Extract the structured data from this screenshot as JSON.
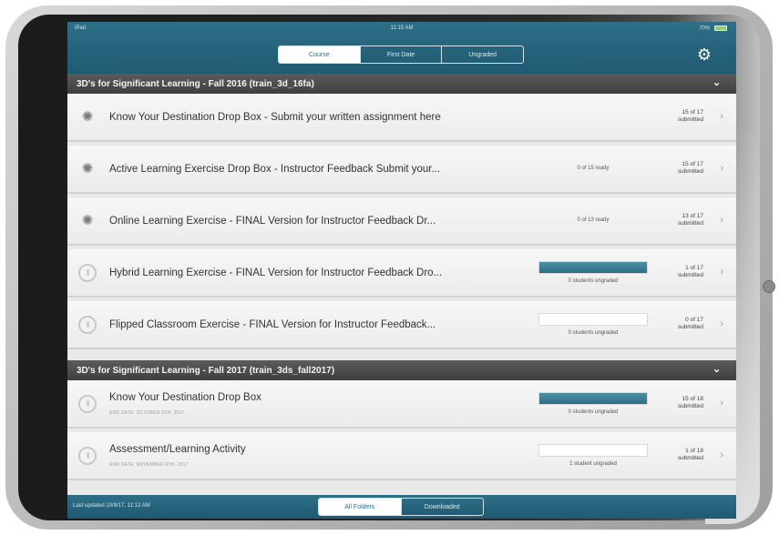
{
  "status_bar": {
    "carrier": "iPad",
    "time": "11:15 AM",
    "battery": "70%"
  },
  "segment": {
    "tabs": [
      "Course",
      "First Date",
      "Ungraded"
    ],
    "active": 0
  },
  "sections": [
    {
      "title": "3D's for Significant Learning - Fall 2016 (train_3d_16fa)",
      "rows": [
        {
          "title": "Know Your Destination Drop Box - Submit your written assignment here",
          "status": "",
          "count": "15 of 17",
          "count_label": "submitted",
          "icon": "spinner-icon"
        },
        {
          "title": "Active Learning Exercise Drop Box - Instructor Feedback Submit your...",
          "status": "0 of 15 ready",
          "count": "15 of 17",
          "count_label": "submitted",
          "icon": "spinner-icon"
        },
        {
          "title": "Online Learning Exercise -  FINAL Version for Instructor Feedback Dr...",
          "status": "0 of 13 ready",
          "count": "13 of 17",
          "count_label": "submitted",
          "icon": "spinner-icon"
        },
        {
          "title": "Hybrid Learning Exercise - FINAL Version for Instructor Feedback Dro...",
          "status": "0 students ungraded",
          "count": "1 of 17",
          "count_label": "submitted",
          "icon": "download-icon",
          "progress": 1.0
        },
        {
          "title": "Flipped Classroom Exercise - FINAL Version for Instructor Feedback...",
          "status": "0 students ungraded",
          "count": "0 of 17",
          "count_label": "submitted",
          "icon": "download-icon",
          "progress": 0.0
        }
      ]
    },
    {
      "title": "3D's for Significant Learning - Fall 2017 (train_3ds_fall2017)",
      "rows": [
        {
          "title": "Know Your Destination Drop Box",
          "subtitle": "END DATE: OCTOBER 6TH, 2017",
          "status": "0 students ungraded",
          "count": "15 of 18",
          "count_label": "submitted",
          "icon": "download-icon",
          "progress": 1.0
        },
        {
          "title": "Assessment/Learning Activity",
          "subtitle": "END DATE: NOVEMBER 6TH, 2017",
          "status": "1 student ungraded",
          "count": "1 of 18",
          "count_label": "submitted",
          "icon": "download-icon",
          "progress": 0.0
        }
      ]
    }
  ],
  "bottom_bar": {
    "last_updated": "Last updated 10/9/17, 11:12 AM",
    "tabs": [
      "All Folders",
      "Downloaded"
    ],
    "active": 0
  },
  "colors": {
    "accent": "#2d6f87",
    "section_header": "#4a4a4a",
    "row_bg": "#f2f2f2"
  }
}
